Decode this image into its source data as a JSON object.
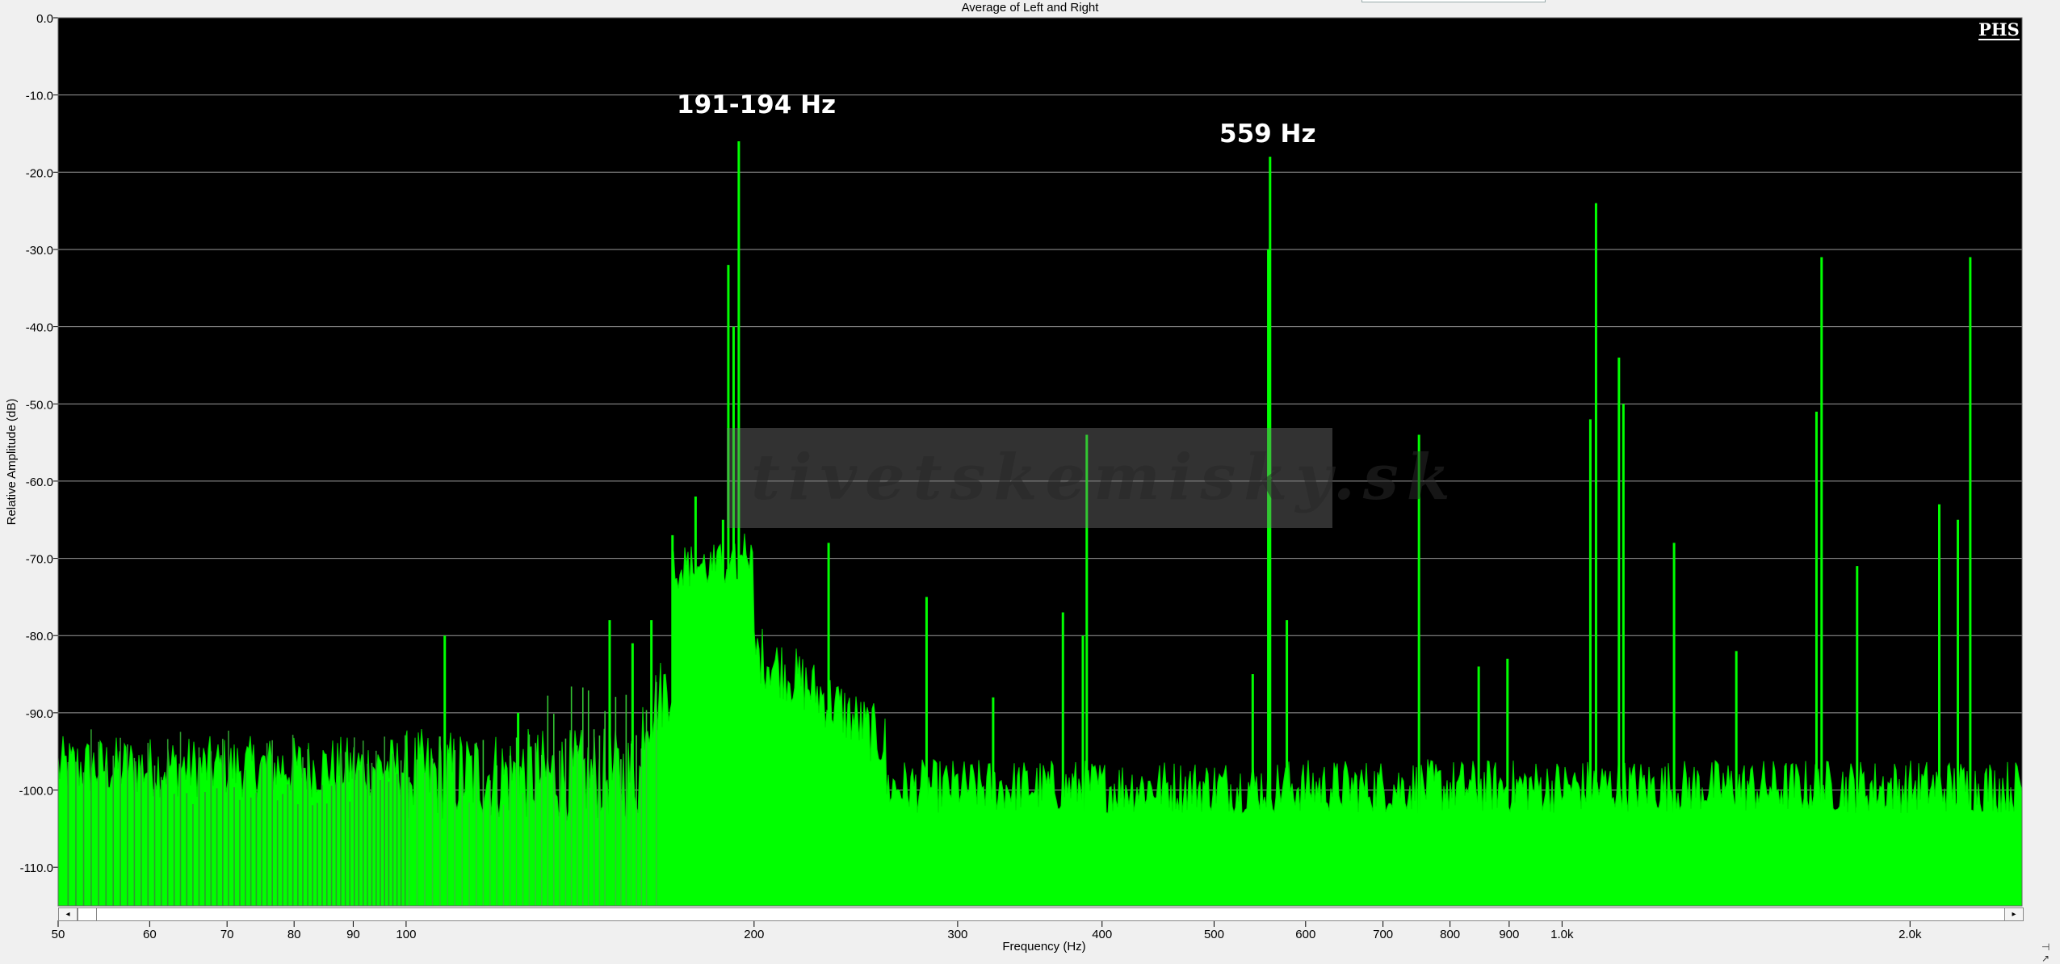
{
  "chart_data": {
    "type": "area",
    "title": "Average of Left and Right",
    "xlabel": "Frequency (Hz)",
    "ylabel": "Relative Amplitude (dB)",
    "x_scale": "log",
    "xlim": [
      50,
      2500
    ],
    "ylim": [
      -115,
      0
    ],
    "grid": true,
    "background": "#000000",
    "series_color": "#00ff00",
    "x_ticks": [
      {
        "value": 50,
        "label": "50"
      },
      {
        "value": 60,
        "label": "60"
      },
      {
        "value": 70,
        "label": "70"
      },
      {
        "value": 80,
        "label": "80"
      },
      {
        "value": 90,
        "label": "90"
      },
      {
        "value": 100,
        "label": "100"
      },
      {
        "value": 200,
        "label": "200"
      },
      {
        "value": 300,
        "label": "300"
      },
      {
        "value": 400,
        "label": "400"
      },
      {
        "value": 500,
        "label": "500"
      },
      {
        "value": 600,
        "label": "600"
      },
      {
        "value": 700,
        "label": "700"
      },
      {
        "value": 800,
        "label": "800"
      },
      {
        "value": 900,
        "label": "900"
      },
      {
        "value": 1000,
        "label": "1.0k"
      },
      {
        "value": 2000,
        "label": "2.0k"
      }
    ],
    "y_ticks": [
      {
        "value": 0,
        "label": "0.0"
      },
      {
        "value": -10,
        "label": "-10.0"
      },
      {
        "value": -20,
        "label": "-20.0"
      },
      {
        "value": -30,
        "label": "-30.0"
      },
      {
        "value": -40,
        "label": "-40.0"
      },
      {
        "value": -50,
        "label": "-50.0"
      },
      {
        "value": -60,
        "label": "-60.0"
      },
      {
        "value": -70,
        "label": "-70.0"
      },
      {
        "value": -80,
        "label": "-80.0"
      },
      {
        "value": -90,
        "label": "-90.0"
      },
      {
        "value": -100,
        "label": "-100.0"
      },
      {
        "value": -110,
        "label": "-110.0"
      }
    ],
    "peaks": [
      {
        "x": 108,
        "y": -80
      },
      {
        "x": 125,
        "y": -90
      },
      {
        "x": 150,
        "y": -78
      },
      {
        "x": 157,
        "y": -81
      },
      {
        "x": 163,
        "y": -78
      },
      {
        "x": 170,
        "y": -67
      },
      {
        "x": 178,
        "y": -62
      },
      {
        "x": 188,
        "y": -65
      },
      {
        "x": 190,
        "y": -32
      },
      {
        "x": 192,
        "y": -40
      },
      {
        "x": 194,
        "y": -16
      },
      {
        "x": 232,
        "y": -68
      },
      {
        "x": 282,
        "y": -75
      },
      {
        "x": 322,
        "y": -88
      },
      {
        "x": 370,
        "y": -77
      },
      {
        "x": 385,
        "y": -80
      },
      {
        "x": 388,
        "y": -54
      },
      {
        "x": 540,
        "y": -85
      },
      {
        "x": 557,
        "y": -30
      },
      {
        "x": 559,
        "y": -18
      },
      {
        "x": 578,
        "y": -78
      },
      {
        "x": 752,
        "y": -54
      },
      {
        "x": 847,
        "y": -84
      },
      {
        "x": 897,
        "y": -83
      },
      {
        "x": 1058,
        "y": -52
      },
      {
        "x": 1070,
        "y": -24
      },
      {
        "x": 1120,
        "y": -44
      },
      {
        "x": 1130,
        "y": -50
      },
      {
        "x": 1250,
        "y": -68
      },
      {
        "x": 1415,
        "y": -82
      },
      {
        "x": 1660,
        "y": -51
      },
      {
        "x": 1677,
        "y": -31
      },
      {
        "x": 1800,
        "y": -71
      },
      {
        "x": 2120,
        "y": -63
      },
      {
        "x": 2200,
        "y": -65
      },
      {
        "x": 2255,
        "y": -31
      }
    ],
    "annotations": [
      {
        "text": "191-194 Hz",
        "x": 194
      },
      {
        "text": "559 Hz",
        "x": 559
      }
    ]
  },
  "watermark": "tivetskemisky.sk",
  "logo": "PHS",
  "scrollbar": {
    "left_arrow": "◂",
    "right_arrow": "▸"
  },
  "resize_icon": "⊣ ↗"
}
